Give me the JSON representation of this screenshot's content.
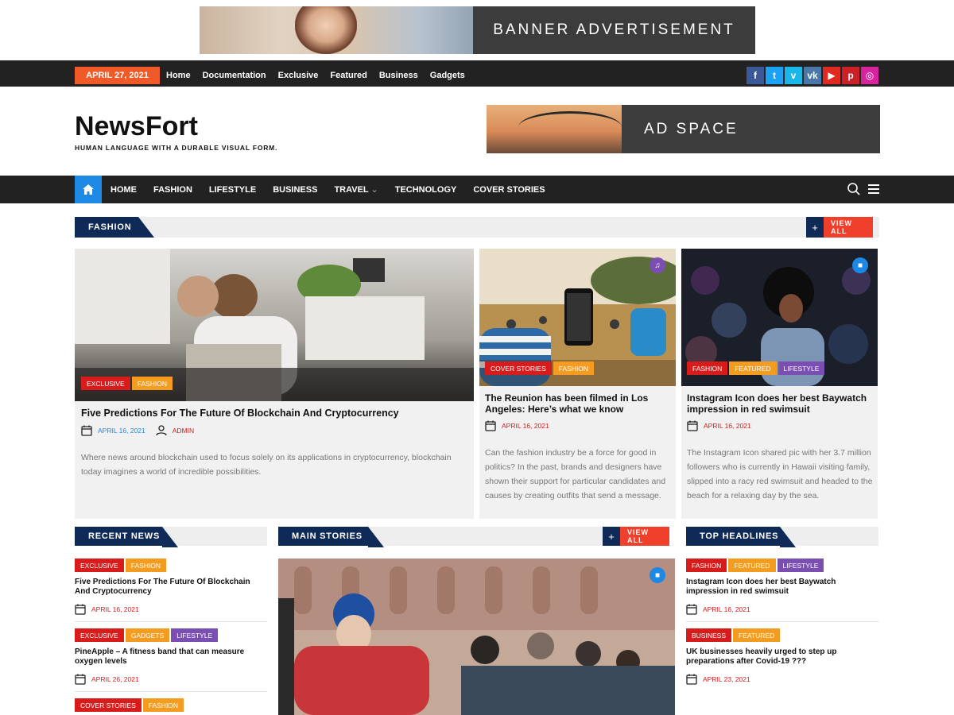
{
  "top_banner": {
    "label": "BANNER ADVERTISEMENT"
  },
  "topbar": {
    "date": "APRIL 27, 2021",
    "links": [
      "Home",
      "Documentation",
      "Exclusive",
      "Featured",
      "Business",
      "Gadgets"
    ]
  },
  "socials": [
    {
      "name": "facebook",
      "glyph": "f",
      "color": "#3b5998"
    },
    {
      "name": "twitter",
      "glyph": "t",
      "color": "#1da1f2"
    },
    {
      "name": "vimeo",
      "glyph": "v",
      "color": "#1ab7ea"
    },
    {
      "name": "vk",
      "glyph": "vk",
      "color": "#4a76a8"
    },
    {
      "name": "youtube",
      "glyph": "▶",
      "color": "#e02a20"
    },
    {
      "name": "pinterest",
      "glyph": "p",
      "color": "#cb2027"
    },
    {
      "name": "instagram",
      "glyph": "◎",
      "color": "#d6249f"
    }
  ],
  "header": {
    "logo": "NewsFort",
    "tagline": "HUMAN LANGUAGE WITH A DURABLE VISUAL FORM.",
    "ad_label": "AD SPACE"
  },
  "nav": {
    "items": [
      "HOME",
      "FASHION",
      "LIFESTYLE",
      "BUSINESS",
      "TRAVEL",
      "TECHNOLOGY",
      "COVER STORIES"
    ],
    "travel_dropdown": "⌄"
  },
  "fashion": {
    "heading": "FASHION",
    "plus": "+",
    "view_all": "VIEW ALL",
    "main": {
      "tags": [
        "EXCLUSIVE",
        "FASHION"
      ],
      "title": "Five Predictions For The Future Of Blockchain And Cryptocurrency",
      "date": "APRIL 16, 2021",
      "author": "ADMIN",
      "excerpt": "Where news around blockchain used to focus solely on its applications in cryptocurrency, blockchain today imagines a world of incredible possibilities."
    },
    "second": {
      "tags": [
        "COVER STORIES",
        "FASHION"
      ],
      "title": "The Reunion has been filmed in Los Angeles: Here’s what we know",
      "date": "APRIL 16, 2021",
      "excerpt": "Can the fashion industry be a force for good in politics? In the past, brands and designers have shown their support for particular candidates and causes by creating outfits that send a message."
    },
    "third": {
      "tags": [
        "FASHION",
        "FEATURED",
        "LIFESTYLE"
      ],
      "title": "Instagram Icon does her best Baywatch impression in red swimsuit",
      "date": "APRIL 16, 2021",
      "excerpt": "The Instagram Icon shared pic with her 3.7 million followers who is currently in Hawaii visiting family, slipped into a racy red swimsuit and headed to the beach for a relaxing day by the sea."
    }
  },
  "recent_news": {
    "heading": "RECENT NEWS",
    "items": [
      {
        "tags": [
          "EXCLUSIVE",
          "FASHION"
        ],
        "title": "Five Predictions For The Future Of Blockchain And Cryptocurrency",
        "date": "APRIL 16, 2021"
      },
      {
        "tags": [
          "EXCLUSIVE",
          "GADGETS",
          "LIFESTYLE"
        ],
        "title": "PineApple – A fitness band that can measure oxygen levels",
        "date": "APRIL 26, 2021"
      },
      {
        "tags": [
          "COVER STORIES",
          "FASHION"
        ]
      }
    ]
  },
  "main_stories": {
    "heading": "MAIN STORIES",
    "plus": "+",
    "view_all": "VIEW ALL"
  },
  "top_headlines": {
    "heading": "TOP HEADLINES",
    "items": [
      {
        "tags": [
          "FASHION",
          "FEATURED",
          "LIFESTYLE"
        ],
        "title": "Instagram Icon does her best Baywatch impression in red swimsuit",
        "date": "APRIL 16, 2021"
      },
      {
        "tags": [
          "BUSINESS",
          "FEATURED"
        ],
        "title": "UK businesses heavily urged to step up preparations after Covid-19 ???",
        "date": "APRIL 23, 2021"
      }
    ]
  }
}
